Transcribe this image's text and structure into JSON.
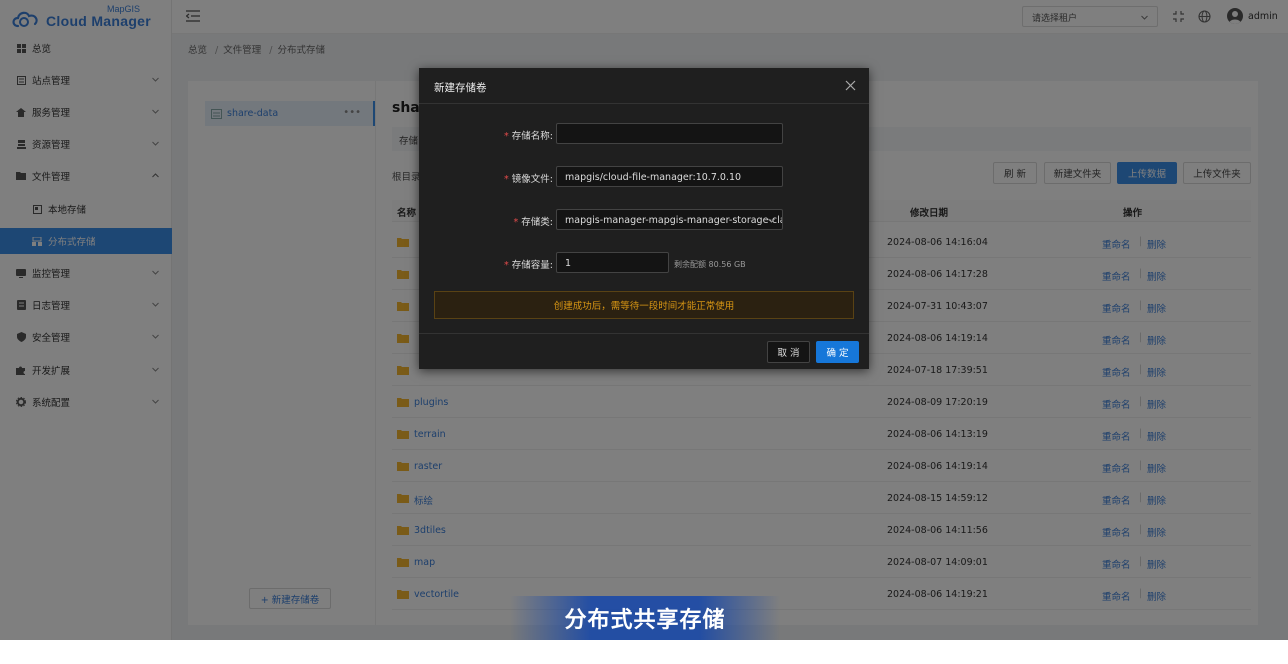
{
  "app": {
    "logo_small": "MapGIS",
    "logo_main": "Cloud Manager"
  },
  "sidebar": {
    "items": [
      {
        "label": "总览"
      },
      {
        "label": "站点管理"
      },
      {
        "label": "服务管理"
      },
      {
        "label": "资源管理"
      },
      {
        "label": "文件管理"
      },
      {
        "label": "本地存储"
      },
      {
        "label": "分布式存储"
      },
      {
        "label": "监控管理"
      },
      {
        "label": "日志管理"
      },
      {
        "label": "安全管理"
      },
      {
        "label": "开发扩展"
      },
      {
        "label": "系统配置"
      }
    ]
  },
  "header": {
    "tenant_placeholder": "请选择租户",
    "user": "admin"
  },
  "breadcrumb": [
    "总览",
    "文件管理",
    "分布式存储"
  ],
  "volumes": {
    "items": [
      {
        "label": "share-data"
      }
    ],
    "new_button": "+ 新建存储卷"
  },
  "content": {
    "title": "shar",
    "info_label": "存储",
    "root_label": "根目录",
    "buttons": {
      "refresh": "刷 新",
      "new_folder": "新建文件夹",
      "upload_data": "上传数据",
      "upload_folder": "上传文件夹"
    },
    "columns": {
      "name": "名称",
      "date": "修改日期",
      "ops": "操作"
    },
    "rows": [
      {
        "name": "",
        "date": "2024-08-06 14:16:04"
      },
      {
        "name": "",
        "date": "2024-08-06 14:17:28"
      },
      {
        "name": "",
        "date": "2024-07-31 10:43:07"
      },
      {
        "name": "",
        "date": "2024-08-06 14:19:14"
      },
      {
        "name": "",
        "date": "2024-07-18 17:39:51"
      },
      {
        "name": "plugins",
        "date": "2024-08-09 17:20:19"
      },
      {
        "name": "terrain",
        "date": "2024-08-06 14:13:19"
      },
      {
        "name": "raster",
        "date": "2024-08-06 14:19:14"
      },
      {
        "name": "标绘",
        "date": "2024-08-15 14:59:12"
      },
      {
        "name": "3dtiles",
        "date": "2024-08-06 14:11:56"
      },
      {
        "name": "map",
        "date": "2024-08-07 14:09:01"
      },
      {
        "name": "vectortile",
        "date": "2024-08-06 14:19:21"
      }
    ],
    "rename": "重命名",
    "delete": "删除"
  },
  "modal": {
    "title": "新建存储卷",
    "fields": {
      "name_label": "存储名称:",
      "name_value": "",
      "image_label": "镜像文件:",
      "image_value": "mapgis/cloud-file-manager:10.7.0.10",
      "class_label": "存储类:",
      "class_value": "mapgis-manager-mapgis-manager-storage-cla...",
      "capacity_label": "存储容量:",
      "capacity_value": "1",
      "capacity_hint": "剩余配额 80.56 GB"
    },
    "alert": "创建成功后，需等待一段时间才能正常使用",
    "cancel": "取 消",
    "ok": "确 定"
  },
  "caption": "分布式共享存储",
  "colors": {
    "accent": "#3b8ee8",
    "modal_bg": "#1f1f1f",
    "alert_text": "#d89614"
  }
}
